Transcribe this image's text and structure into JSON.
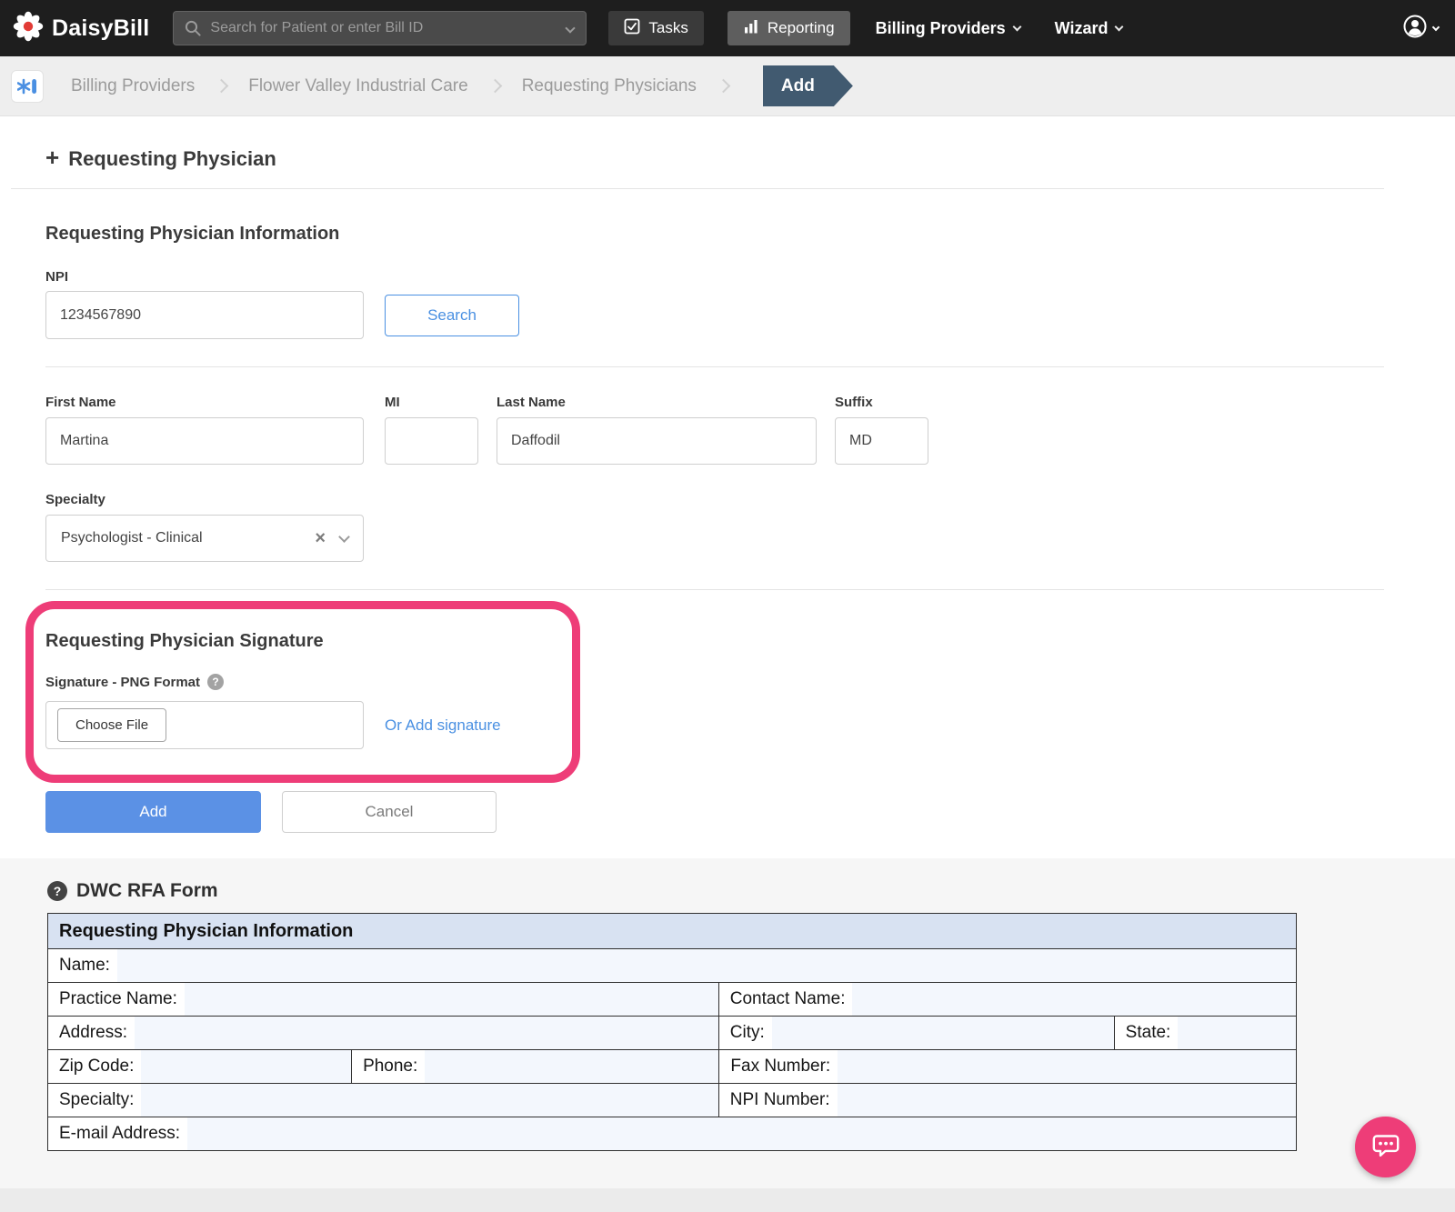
{
  "colors": {
    "navbar_bg": "#1e1e1e",
    "accent_blue": "#4a90e2",
    "primary_button_bg": "#5b91e5",
    "highlight_pink": "#ee3d78",
    "breadcrumb_active_bg": "#415a70",
    "table_header_bg": "#d8e2f2"
  },
  "icons": {
    "plus": "+",
    "clear": "×",
    "help": "?"
  },
  "navbar": {
    "brand": "DaisyBill",
    "search": {
      "placeholder": "Search for Patient or enter Bill ID"
    },
    "tasks_label": "Tasks",
    "reporting_label": "Reporting",
    "billing_providers_label": "Billing Providers",
    "wizard_label": "Wizard"
  },
  "breadcrumb": {
    "items": [
      {
        "label": "Billing Providers"
      },
      {
        "label": "Flower Valley Industrial Care"
      },
      {
        "label": "Requesting Physicians"
      }
    ],
    "active": "Add"
  },
  "page": {
    "title": "Requesting Physician"
  },
  "form": {
    "section_heading": "Requesting Physician Information",
    "npi_label": "NPI",
    "npi_value": "1234567890",
    "search_button": "Search",
    "first_name_label": "First Name",
    "first_name_value": "Martina",
    "mi_label": "MI",
    "mi_value": "",
    "last_name_label": "Last Name",
    "last_name_value": "Daffodil",
    "suffix_label": "Suffix",
    "suffix_value": "MD",
    "specialty_label": "Specialty",
    "specialty_value": "Psychologist - Clinical",
    "signature_heading": "Requesting Physician Signature",
    "signature_label": "Signature - PNG Format",
    "choose_file_button": "Choose File",
    "add_signature_link": "Or Add signature",
    "add_button": "Add",
    "cancel_button": "Cancel"
  },
  "rfa": {
    "heading": "DWC RFA Form",
    "table": {
      "header": "Requesting Physician Information",
      "rows": [
        {
          "cells": [
            {
              "label": "Name:"
            }
          ]
        },
        {
          "cells": [
            {
              "label": "Practice Name:"
            },
            {
              "label": "Contact Name:"
            }
          ]
        },
        {
          "cells": [
            {
              "label": "Address:"
            },
            {
              "label": "City:"
            },
            {
              "label": "State:"
            }
          ]
        },
        {
          "cells": [
            {
              "label": "Zip Code:"
            },
            {
              "label": "Phone:"
            },
            {
              "label": "Fax Number:"
            }
          ]
        },
        {
          "cells": [
            {
              "label": "Specialty:"
            },
            {
              "label": "NPI Number:"
            }
          ]
        },
        {
          "cells": [
            {
              "label": "E-mail Address:"
            }
          ]
        }
      ]
    }
  }
}
